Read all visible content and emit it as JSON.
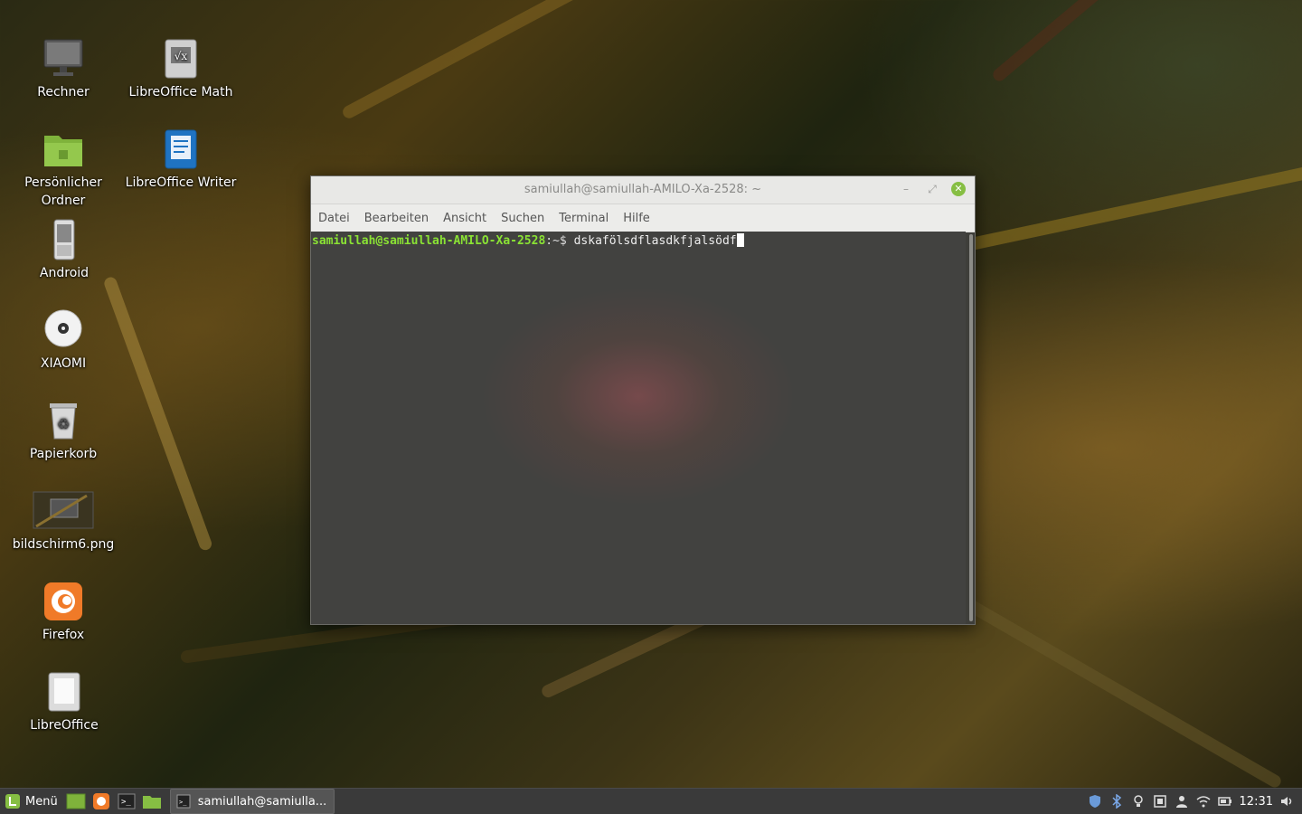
{
  "desktop": {
    "icons": [
      {
        "label": "Rechner"
      },
      {
        "label": "LibreOffice Math"
      },
      {
        "label": "Persönlicher Ordner"
      },
      {
        "label": "LibreOffice Writer"
      },
      {
        "label": "Android"
      },
      {
        "label": "XIAOMI"
      },
      {
        "label": "Papierkorb"
      },
      {
        "label": "bildschirm6.png"
      },
      {
        "label": "Firefox"
      },
      {
        "label": "LibreOffice"
      }
    ]
  },
  "terminal": {
    "title": "samiullah@samiullah-AMILO-Xa-2528: ~",
    "menu": [
      "Datei",
      "Bearbeiten",
      "Ansicht",
      "Suchen",
      "Terminal",
      "Hilfe"
    ],
    "prompt_user": "samiullah@samiullah-AMILO-Xa-2528",
    "prompt_path": ":~$ ",
    "command": "dskafölsdflasdkfjalsödf"
  },
  "taskbar": {
    "menu_label": "Menü",
    "task_label": "samiullah@samiulla...",
    "clock": "12:31"
  },
  "colors": {
    "mint_green": "#86be43",
    "prompt_green": "#8ae234",
    "taskbar_bg": "#3a3a3a"
  }
}
